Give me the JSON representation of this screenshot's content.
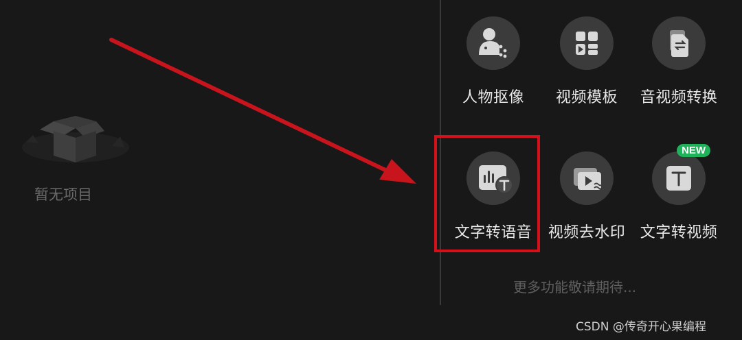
{
  "left_pane": {
    "empty_label": "暂无项目"
  },
  "tools": [
    {
      "label": "人物抠像",
      "icon": "person-cutout-icon"
    },
    {
      "label": "视频模板",
      "icon": "video-template-icon"
    },
    {
      "label": "音视频转换",
      "icon": "av-convert-icon"
    },
    {
      "label": "文字转语音",
      "icon": "text-to-speech-icon"
    },
    {
      "label": "视频去水印",
      "icon": "remove-watermark-icon"
    },
    {
      "label": "文字转视频",
      "icon": "text-to-video-icon"
    }
  ],
  "new_badge": "NEW",
  "more_features": "更多功能敬请期待...",
  "watermark": "CSDN @传奇开心果编程",
  "colors": {
    "background": "#181818",
    "icon_circle": "#3b3b3b",
    "highlight": "#d6101a",
    "new_badge": "#1fb25a"
  }
}
